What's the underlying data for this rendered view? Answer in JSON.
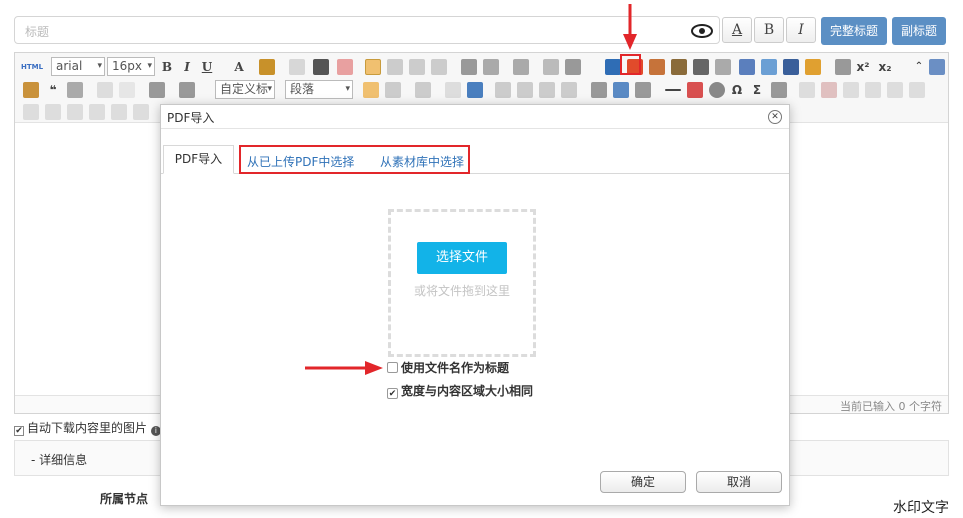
{
  "title_field": {
    "placeholder": "标题"
  },
  "title_format_buttons": [
    "A",
    "B",
    "I"
  ],
  "title_buttons": {
    "full_title": "完整标题",
    "subtitle": "副标题"
  },
  "toolbar": {
    "font_family": "arial",
    "font_size": "16px",
    "custom_title": "自定义标",
    "paragraph": "段落",
    "row1_text_icons": [
      "B",
      "I",
      "U",
      "A",
      "Ω",
      "Σ",
      "x²",
      "x₂"
    ]
  },
  "status": {
    "char_count": "当前已输入 0 个字符"
  },
  "auto_download": {
    "label": "自动下载内容里的图片",
    "checked": true
  },
  "details": {
    "label": "-   详细信息"
  },
  "node_label": "所属节点",
  "watermark": "水印文字",
  "modal": {
    "title": "PDF导入",
    "tabs": [
      "PDF导入",
      "从已上传PDF中选择",
      "从素材库中选择"
    ],
    "choose_file": "选择文件",
    "drop_hint": "或将文件拖到这里",
    "options": [
      {
        "label": "使用文件名作为标题",
        "checked": false
      },
      {
        "label": "宽度与内容区域大小相同",
        "checked": true
      }
    ],
    "confirm": "确定",
    "cancel": "取消"
  },
  "colors": {
    "accent_blue": "#5b8fc4",
    "upload_button": "#12b3e8",
    "annotation_red": "#e2262a",
    "link_blue": "#2f72b8"
  },
  "icons": [
    "eye-icon",
    "html-icon",
    "pdf-import-icon",
    "close-icon",
    "arrow-down-annotation",
    "arrow-right-annotation"
  ]
}
